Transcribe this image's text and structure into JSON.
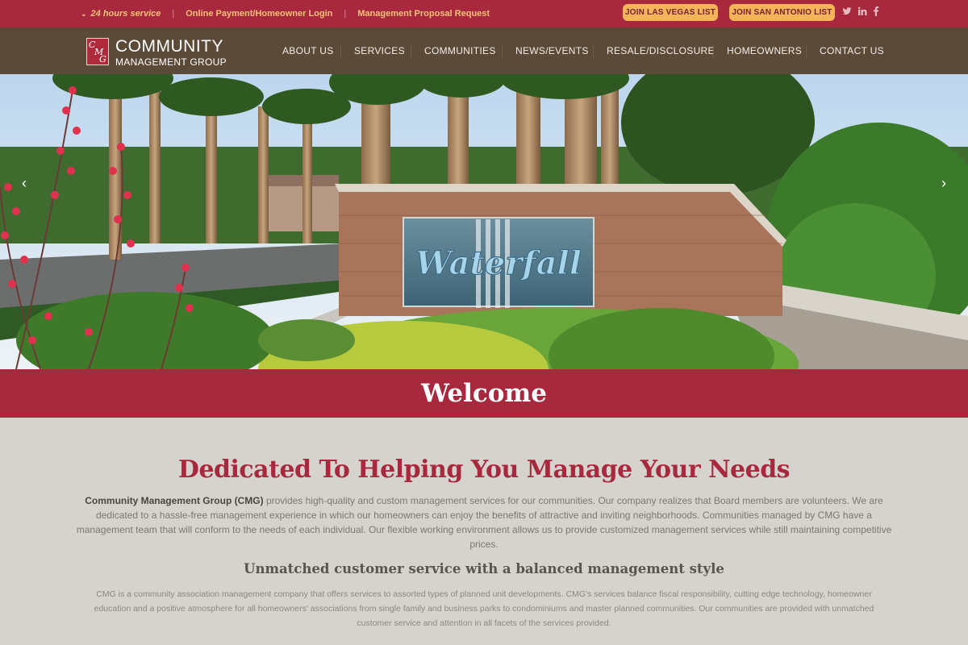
{
  "topbar": {
    "service": "24 hours service",
    "payment_link": "Online Payment/Homeowner Login",
    "proposal_link": "Management Proposal Request",
    "join_vegas": "JOIN LAS VEGAS LIST",
    "join_san_antonio": "JOIN SAN ANTONIO LIST",
    "social_icons": [
      "twitter-icon",
      "linkedin-icon",
      "facebook-icon"
    ]
  },
  "logo": {
    "monogram": "CMG",
    "line1": "COMMUNITY",
    "line2": "MANAGEMENT GROUP"
  },
  "nav": {
    "about": "ABOUT US",
    "services": "SERVICES",
    "communities": "COMMUNITIES",
    "news": "NEWS/EVENTS",
    "resale": "RESALE/DISCLOSURE",
    "homeowners": "HOMEOWNERS",
    "contact": "CONTACT US"
  },
  "hero": {
    "sign_text": "Waterfall"
  },
  "welcome": "Welcome",
  "main": {
    "headline": "Dedicated To Helping You Manage Your Needs",
    "para1_strong": "Community Management Group (CMG)",
    "para1_rest": " provides high-quality and custom management services for our communities. Our company realizes that Board members are volunteers. We are dedicated to a hassle-free management experience in which our homeowners can enjoy the benefits of attractive and inviting neighborhoods. Communities managed by CMG have a management team that will conform to the needs of each individual. Our flexible working environment allows us to provide customized management services while still maintaining competitive prices.",
    "subheading": "Unmatched customer service with a balanced management style",
    "para2": "CMG is a community association management company that offers services to assorted types of planned unit developments. CMG's services balance fiscal responsibility, cutting edge technology, homeowner education and a positive atmosphere for all homeowners' associations from single family and business parks to condominiums and master planned communities. Our communities are provided with unmatched customer service and attention in all facets of the services provided."
  },
  "colors": {
    "brand_red": "#a8293d",
    "nav_brown": "#5c4a39",
    "accent_orange": "#f5b35a",
    "page_bg": "#d6d2cd"
  }
}
